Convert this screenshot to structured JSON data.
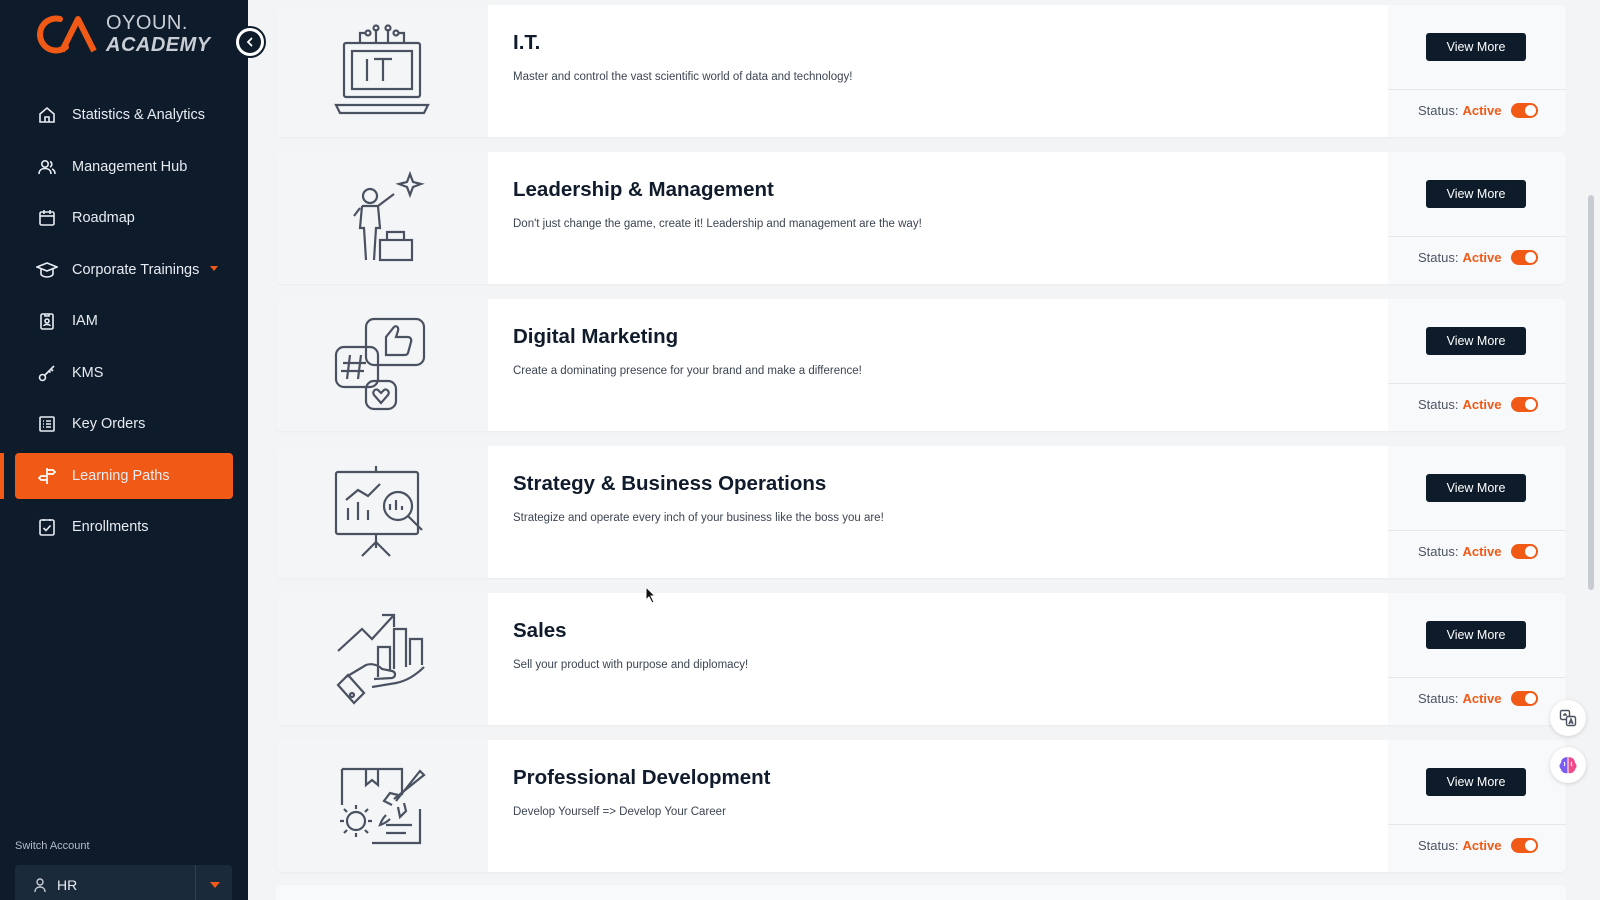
{
  "brand": {
    "line1": "OYOUN.",
    "line2": "ACADEMY",
    "accent": "#f15a16",
    "sidebar_bg": "#0d1b2a"
  },
  "sidebar": {
    "items": [
      {
        "label": "Statistics & Analytics",
        "icon": "home-icon"
      },
      {
        "label": "Management Hub",
        "icon": "users-icon"
      },
      {
        "label": "Roadmap",
        "icon": "calendar-icon"
      },
      {
        "label": "Corporate Trainings",
        "icon": "graduation-cap-icon"
      },
      {
        "label": "IAM",
        "icon": "badge-icon"
      },
      {
        "label": "KMS",
        "icon": "key-icon"
      },
      {
        "label": "Key Orders",
        "icon": "list-icon"
      },
      {
        "label": "Learning Paths",
        "icon": "signpost-icon",
        "active": true
      },
      {
        "label": "Enrollments",
        "icon": "checklist-icon"
      }
    ],
    "switch_account_label": "Switch Account",
    "account_value": "HR"
  },
  "cards": [
    {
      "title": "I.T.",
      "description": "Master and control the vast scientific world of data and technology!",
      "button": "View More",
      "status_label": "Status:",
      "status_value": "Active",
      "icon": "it-laptop-icon"
    },
    {
      "title": "Leadership & Management",
      "description": "Don't just change the game, create it! Leadership and management are the way!",
      "button": "View More",
      "status_label": "Status:",
      "status_value": "Active",
      "icon": "leader-podium-icon"
    },
    {
      "title": "Digital Marketing",
      "description": "Create a dominating presence for your brand and make a difference!",
      "button": "View More",
      "status_label": "Status:",
      "status_value": "Active",
      "icon": "social-media-icon"
    },
    {
      "title": "Strategy & Business Operations",
      "description": "Strategize and operate every inch of your business like the boss you are!",
      "button": "View More",
      "status_label": "Status:",
      "status_value": "Active",
      "icon": "strategy-board-icon"
    },
    {
      "title": "Sales",
      "description": "Sell your product with purpose and diplomacy!",
      "button": "View More",
      "status_label": "Status:",
      "status_value": "Active",
      "icon": "sales-growth-icon"
    },
    {
      "title": "Professional Development",
      "description": "Develop Yourself => Develop Your Career",
      "button": "View More",
      "status_label": "Status:",
      "status_value": "Active",
      "icon": "rocket-gear-icon"
    }
  ]
}
